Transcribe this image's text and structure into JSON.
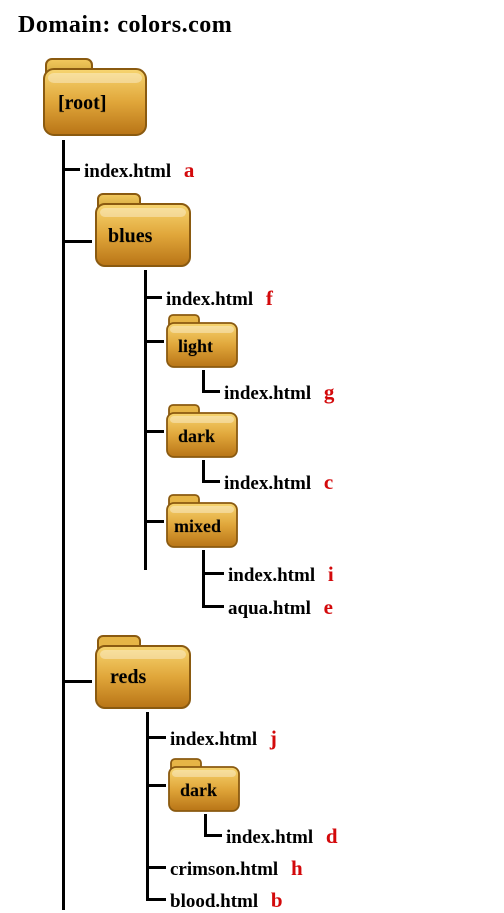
{
  "title": "Domain: colors.com",
  "root": {
    "label": "[root]"
  },
  "root_index": {
    "name": "index.html",
    "letter": "a"
  },
  "blues": {
    "label": "blues"
  },
  "blues_index": {
    "name": "index.html",
    "letter": "f"
  },
  "light": {
    "label": "light"
  },
  "light_index": {
    "name": "index.html",
    "letter": "g"
  },
  "dark_b": {
    "label": "dark"
  },
  "dark_b_index": {
    "name": "index.html",
    "letter": "c"
  },
  "mixed": {
    "label": "mixed"
  },
  "mixed_index": {
    "name": "index.html",
    "letter": "i"
  },
  "mixed_aqua": {
    "name": "aqua.html",
    "letter": "e"
  },
  "reds": {
    "label": "reds"
  },
  "reds_index": {
    "name": "index.html",
    "letter": "j"
  },
  "dark_r": {
    "label": "dark"
  },
  "dark_r_index": {
    "name": "index.html",
    "letter": "d"
  },
  "crimson": {
    "name": "crimson.html",
    "letter": "h"
  },
  "blood": {
    "name": "blood.html",
    "letter": "b"
  }
}
